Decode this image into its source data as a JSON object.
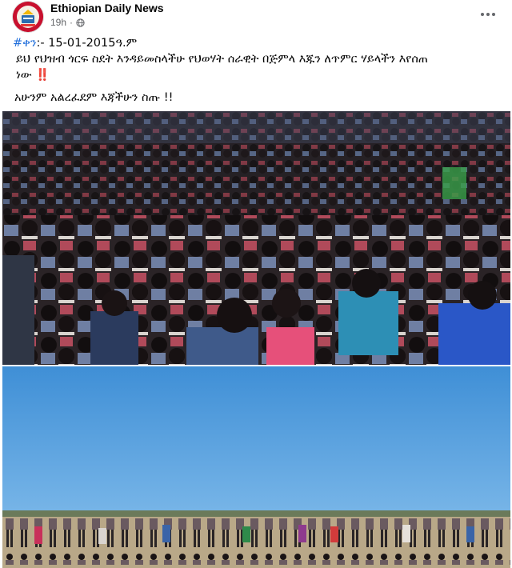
{
  "post": {
    "page_name": "Ethiopian Daily News",
    "time": "19h",
    "dot": "·",
    "visibility_icon": "globe-icon",
    "more_icon": "more-options-icon",
    "hashtag": "#ቀን",
    "date_line": ":- 15-01-2015ዓ.ም",
    "line1": "ይህ የህዝብ ጎርፍ ስደት እንዳይመስላችሁ የህወሃት ሰራዊት በጅምላ እጁን ለጥምር ሃይላችን እየሰጠ",
    "line2": "ነው",
    "line2_emoji": "‼️",
    "line3": "አሁንም አልረፈደም እጃችሁን ስጡ !!"
  },
  "colors": {
    "text": "#050505",
    "secondary": "#65676b",
    "hashtag": "#216fdb",
    "avatar": "#c8102e"
  }
}
